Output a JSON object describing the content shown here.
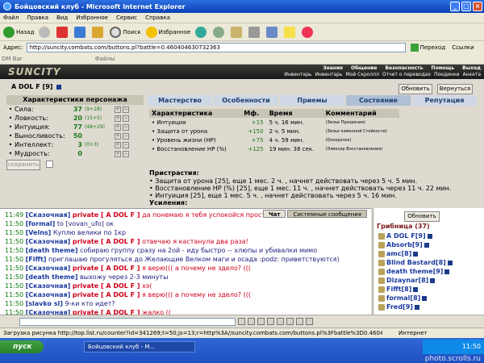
{
  "window": {
    "title": "Бойцовский клуб - Microsoft Internet Explorer"
  },
  "menu": [
    "Файл",
    "Правка",
    "Вид",
    "Избранное",
    "Сервис",
    "Справка"
  ],
  "toolbar": {
    "back": "Назад",
    "search": "Поиск",
    "favorites": "Избранное"
  },
  "address": {
    "label": "Адрес:",
    "url": "http://suncity.combats.com/buttons.pl?battle=0.460404630732363",
    "go": "Переход",
    "links": "Ссылки"
  },
  "linksbar": {
    "dm": "DM Bar",
    "files": "Файлы"
  },
  "game": {
    "logo": "SUNCITY",
    "topnav": [
      "Знания",
      "Общение",
      "Безопасность",
      "Помощь",
      "Выход"
    ],
    "subnav": [
      "Инвентарь",
      "Инвентарь",
      "Мой Скроллл",
      "Отчет о переводах",
      "Поединки",
      "Анкета"
    ],
    "char": {
      "name": "A DOL F",
      "level": "[9]"
    },
    "buttons": {
      "refresh": "Обновить",
      "back": "Вернуться",
      "save": "сохранить",
      "online_refresh": "Обновить"
    },
    "stats_title": "Характеристики персонажа",
    "stats": [
      {
        "name": "Сила:",
        "value": "37",
        "bonus": "(9+28)"
      },
      {
        "name": "Ловкость:",
        "value": "20",
        "bonus": "(15+5)"
      },
      {
        "name": "Интуиция:",
        "value": "77",
        "bonus": "(48+29)"
      },
      {
        "name": "Выносливость:",
        "value": "50",
        "bonus": ""
      },
      {
        "name": "Интеллект:",
        "value": "3",
        "bonus": "(0+3)"
      },
      {
        "name": "Мудрость:",
        "value": "0",
        "bonus": ""
      }
    ],
    "tabs": [
      "Мастерство",
      "Особенности",
      "Приемы",
      "Состояние",
      "Репутация"
    ],
    "effects": {
      "headers": [
        "Характеристика",
        "Мф.",
        "Время",
        "Комментарий"
      ],
      "rows": [
        {
          "name": "Интуиция",
          "mf": "+15",
          "time": "5 ч. 16 мин.",
          "comment": "(Зелье Прозрения)"
        },
        {
          "name": "Защита от урона",
          "mf": "+150",
          "time": "2 ч. 5 мин.",
          "comment": "(Зелье каменной Стойкости)"
        },
        {
          "name": "Уровень жизни (HP)",
          "mf": "+75",
          "time": "4 ч. 59 мин.",
          "comment": "(Оскорочок)"
        },
        {
          "name": "Восстановление HP (%)",
          "mf": "+125",
          "time": "19 мин. 38 сек.",
          "comment": "(Эликсир Восстановления)"
        }
      ]
    },
    "bonuses": {
      "title": "Пристрастия:",
      "items": [
        "Защита от урона [25], еще 1 мес. 2 ч. , начнет действовать через 5 ч. 5 мин.",
        "Восстановление HP (%) [25], еще 1 мес. 11 ч. , начнет действовать через 11 ч. 22 мин.",
        "Интуиция [25], еще 1 мес. 5 ч. , начнет действовать через 5 ч. 16 мин."
      ],
      "more": "Усиления:"
    },
    "chat": {
      "tabs": [
        "Чат",
        "Системные сообщения"
      ],
      "lines": [
        {
          "time": "11:49",
          "nick": "[Сказочная]",
          "private": "private [ A DOL F ]",
          "msg": "да понемаю я тебя успокойся просто"
        },
        {
          "time": "11:50",
          "nick": "[formal]",
          "private": "",
          "msg": "to [vovan_ufo] ок"
        },
        {
          "time": "11:50",
          "nick": "[Velns]",
          "private": "",
          "msg": "Куплю велики по 1кр"
        },
        {
          "time": "11:50",
          "nick": "[Сказочная]",
          "private": "private [ A DOL F ]",
          "msg": "отвечаю я кастанула два раза!"
        },
        {
          "time": "11:50",
          "nick": "[death theme]",
          "private": "",
          "msg": "собираю группу сразу на 2ой - иду быстро -- хлюпы и убивалки мимо"
        },
        {
          "time": "11:50",
          "nick": "[Fifft]",
          "private": "",
          "msg": "приглашаю прогуляться до  Желающие Велком  маги  и осада :podz: приветствуются)"
        },
        {
          "time": "11:50",
          "nick": "[Сказочная]",
          "private": "private [ A DOL F ]",
          "msg": "я верю((( а почему не здело? ((("
        },
        {
          "time": "11:50",
          "nick": "[death theme]",
          "private": "",
          "msg": "выхожу через 2-3 минуты"
        },
        {
          "time": "11:50",
          "nick": "[Сказочная]",
          "private": "private [ A DOL F ]",
          "msg": "хэ("
        },
        {
          "time": "11:50",
          "nick": "[Сказочная]",
          "private": "private [ A DOL F ]",
          "msg": "я верю((( а почему не здело? ((("
        },
        {
          "time": "11:50",
          "nick": "[slavko sl]",
          "private": "",
          "msg": "9-ки кто идет?"
        },
        {
          "time": "11:50",
          "nick": "[Сказочная]",
          "private": "private [ A DOL F ]",
          "msg": "жалко (("
        }
      ]
    },
    "online": {
      "title": "Грибница (37)",
      "users": [
        {
          "name": "A DOL F",
          "level": "[9]"
        },
        {
          "name": "Absorb",
          "level": "[9]"
        },
        {
          "name": "amc",
          "level": "[8]"
        },
        {
          "name": "Blind Bastard",
          "level": "[8]"
        },
        {
          "name": "death theme",
          "level": "[9]"
        },
        {
          "name": "Dizaynar",
          "level": "[8]"
        },
        {
          "name": "Fifft",
          "level": "[8]"
        },
        {
          "name": "formal",
          "level": "[8]"
        },
        {
          "name": "Fred",
          "level": "[9]"
        }
      ]
    }
  },
  "status": {
    "text": "Загрузка рисунка http://top.list.ru/counter?id=341269;t=50;js=13;r=http%3A//suncity.combats.com/buttons.pl%3Fbattle%3D0.460404",
    "zone": "Интернет"
  },
  "taskbar": {
    "start": "пуск",
    "item": "Бойцовский клуб - M...",
    "clock": "11:50"
  },
  "watermark": "photo.scrolls.ru"
}
